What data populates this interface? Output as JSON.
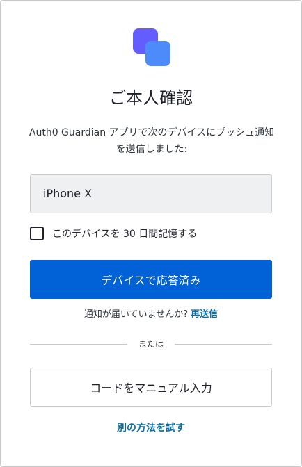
{
  "colors": {
    "primary": "#0062d6",
    "link": "#0a6fa6",
    "logo_back": "#635dff",
    "logo_front": "#4d8bfa"
  },
  "logo": {
    "icon": "guardian-logo-icon"
  },
  "title": "ご本人確認",
  "description": "Auth0 Guardian アプリで次のデバイスにプッシュ通知を送信しました:",
  "device": {
    "name": "iPhone X"
  },
  "remember": {
    "label": "このデバイスを 30 日間記憶する",
    "checked": false
  },
  "primary_button": {
    "label": "デバイスで応答済み"
  },
  "resend": {
    "prompt": "通知が届いていませんか?",
    "link": "再送信"
  },
  "divider": {
    "label": "または"
  },
  "manual_button": {
    "label": "コードをマニュアル入力"
  },
  "alt_method": {
    "label": "別の方法を試す"
  }
}
